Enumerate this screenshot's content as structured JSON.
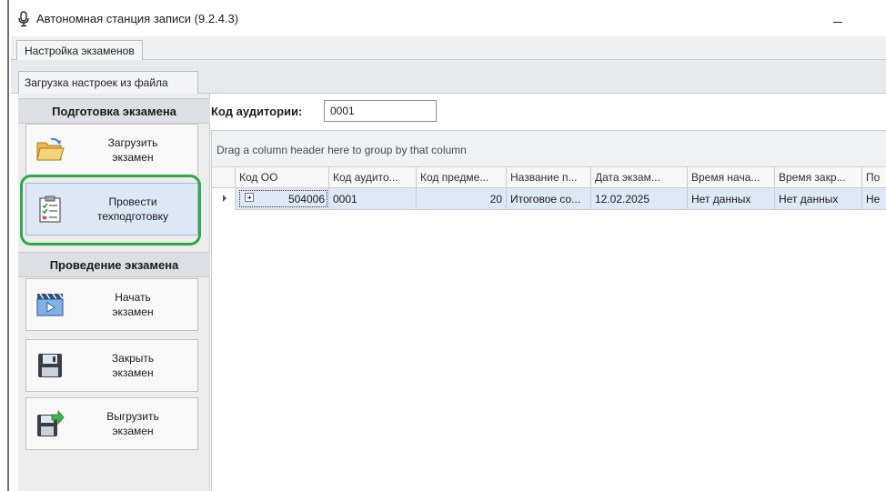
{
  "window": {
    "title": "Автономная станция записи (9.2.4.3)",
    "icon": "microphone-icon",
    "minimize_icon": "minimize-icon"
  },
  "tabs": {
    "level1": [
      "Настройка экзаменов"
    ],
    "level2": [
      "Загрузка настроек из файла"
    ]
  },
  "sidebar": {
    "groups": [
      {
        "title": "Подготовка экзамена",
        "items": [
          {
            "label": "Загрузить\nэкзамен",
            "icon": "folder-open-icon"
          },
          {
            "label": "Провести\nтехподготовку",
            "icon": "checklist-clipboard-icon",
            "active": true
          }
        ]
      },
      {
        "title": "Проведение экзамена",
        "items": [
          {
            "label": "Начать\nэкзамен",
            "icon": "clapperboard-icon"
          },
          {
            "label": "Закрыть\nэкзамен",
            "icon": "floppy-disk-icon"
          },
          {
            "label": "Выгрузить\nэкзамен",
            "icon": "floppy-export-icon"
          }
        ]
      }
    ]
  },
  "auditorium": {
    "label": "Код аудитории:",
    "value": "0001"
  },
  "grid": {
    "group_panel_text": "Drag a column header here to group by that column",
    "columns": [
      "Код ОО",
      "Код аудито...",
      "Код предме...",
      "Название п...",
      "Дата экзам...",
      "Время нача...",
      "Время закр...",
      "По"
    ],
    "rows": [
      [
        "504006",
        "0001",
        "20",
        "Итоговое со...",
        "12.02.2025",
        "Нет данных",
        "Нет данных",
        "Не"
      ]
    ]
  },
  "colors": {
    "highlight_ring": "#2ea84a",
    "selected_row": "#dfe8f6",
    "active_button": "#dce8f6"
  }
}
